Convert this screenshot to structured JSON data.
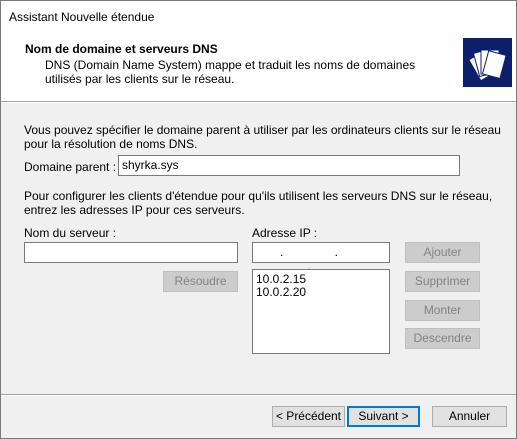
{
  "window": {
    "title": "Assistant Nouvelle étendue"
  },
  "header": {
    "title": "Nom de domaine et serveurs DNS",
    "description": "DNS (Domain Name System) mappe et traduit les noms de domaines utilisés par les clients sur le réseau."
  },
  "intro_text": "Vous pouvez spécifier le domaine parent à utiliser par les ordinateurs clients sur le réseau pour la résolution de noms DNS.",
  "parent_domain": {
    "label": "Domaine parent :",
    "value": "shyrka.sys"
  },
  "dns_intro_text": "Pour configurer les clients d'étendue pour qu'ils utilisent les serveurs DNS sur le réseau, entrez les adresses IP pour ces serveurs.",
  "server_name": {
    "label": "Nom du serveur :",
    "value": ""
  },
  "ip_address": {
    "label": "Adresse IP :",
    "value": ". . ."
  },
  "ip_list": [
    "10.0.2.15",
    "10.0.2.20"
  ],
  "buttons": {
    "resolve": "Résoudre",
    "add": "Ajouter",
    "remove": "Supprimer",
    "up": "Monter",
    "down": "Descendre",
    "back": "< Précédent",
    "next": "Suivant >",
    "cancel": "Annuler"
  }
}
